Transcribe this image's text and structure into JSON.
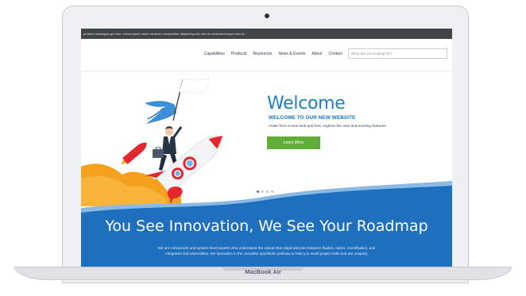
{
  "announcement": "product messages go here. Lorem ipsum dolor sit amet, consectetur adipiscing elit, sed do eiusmod tempor sed ut...",
  "nav": {
    "links": [
      "Capabilities",
      "Products",
      "Resources",
      "News & Events",
      "About",
      "Contact"
    ],
    "search_placeholder": "What are you looking for?"
  },
  "hero": {
    "title": "Welcome",
    "subtitle": "WELCOME TO OUR NEW WEBSITE",
    "text": "Aside from a new look and feel, explore the new and exciting features",
    "cta_label": "Learn More",
    "slides_total": 4,
    "slide_active": 1
  },
  "band": {
    "title": "You See Innovation, We See Your Roadmap",
    "text_line1": "We are component and system-level experts who understand the critical inter-dependencies between fluidics, optics, microfluidics, and",
    "text_line2": "integrated sub-assemblies. We specialize in the complete optofluidic pathway to help you avoid project risks and are uniquely"
  },
  "device": {
    "label": "MacBook Air"
  },
  "colors": {
    "accent_blue": "#1e7dc2",
    "band_blue": "#1f6fbf",
    "cta_green": "#5fae37",
    "announce_bar": "#3f4448"
  }
}
